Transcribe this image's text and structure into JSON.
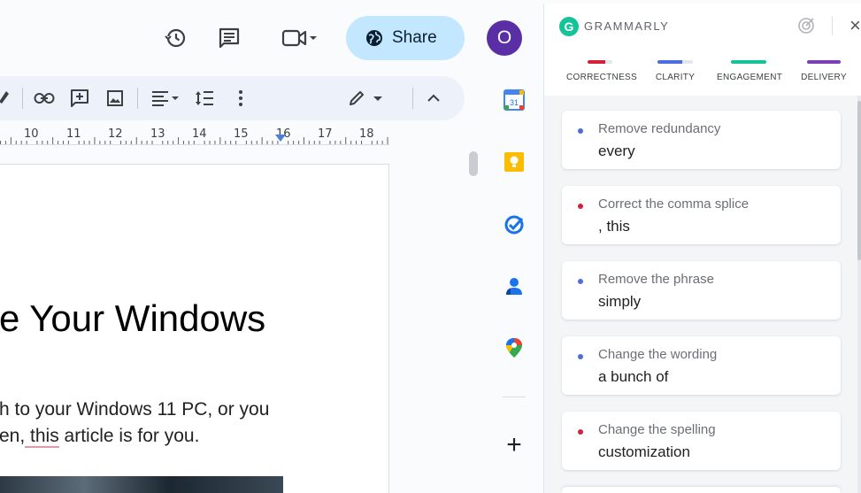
{
  "topbar": {
    "share_label": "Share",
    "avatar_initial": "O",
    "icons": [
      "history-icon",
      "comments-icon",
      "meet-icon",
      "chevron-down-icon",
      "globe-icon"
    ]
  },
  "toolbar": {
    "icons": [
      "paint-format-icon",
      "link-icon",
      "add-comment-icon",
      "image-icon",
      "align-icon",
      "line-spacing-icon",
      "more-icon",
      "edit-mode-icon",
      "collapse-icon"
    ]
  },
  "ruler": {
    "numbers": [
      "10",
      "11",
      "12",
      "13",
      "14",
      "15",
      "16",
      "17",
      "18"
    ]
  },
  "document": {
    "title": "e Your Windows",
    "line1": "h to your Windows 11 PC, or you",
    "line2_start": "en,",
    "line2_underlined": " this",
    "line2_end": " article is for you."
  },
  "rail": {
    "icons": [
      "calendar-icon",
      "keep-icon",
      "tasks-icon",
      "contacts-icon",
      "maps-icon",
      "plus-icon"
    ],
    "calendar_day": "31",
    "plus_glyph": "+"
  },
  "grammarly": {
    "brand": "GRAMMARLY",
    "logo_letter": "G",
    "close_glyph": "×",
    "categories": [
      {
        "label": "CORRECTNESS",
        "color": "#d4213b",
        "fill": 0.7
      },
      {
        "label": "CLARITY",
        "color": "#4a6ee0",
        "fill": 0.7
      },
      {
        "label": "ENGAGEMENT",
        "color": "#15c39a",
        "fill": 1.0
      },
      {
        "label": "DELIVERY",
        "color": "#7b3fb8",
        "fill": 1.0
      }
    ],
    "cards": [
      {
        "title": "Remove redundancy",
        "word": "every",
        "dot": "#4a6ee0"
      },
      {
        "title": "Correct the comma splice",
        "word": ", this",
        "dot": "#d4213b"
      },
      {
        "title": "Remove the phrase",
        "word": "simply",
        "dot": "#4a6ee0"
      },
      {
        "title": "Change the wording",
        "word": "a bunch of",
        "dot": "#4a6ee0"
      },
      {
        "title": "Change the spelling",
        "word": "customization",
        "dot": "#d4213b"
      }
    ]
  }
}
